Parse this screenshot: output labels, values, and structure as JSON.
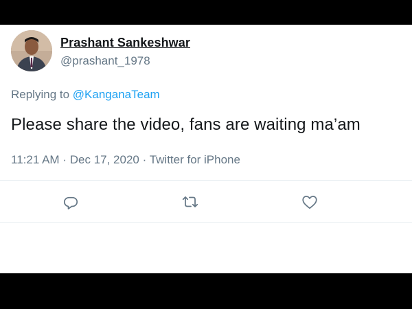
{
  "tweet": {
    "author_name": "Prashant Sankeshwar",
    "author_handle": "@prashant_1978",
    "reply_prefix": "Replying to",
    "reply_handle": "@KanganaTeam",
    "text": "Please share the video, fans are waiting ma’am",
    "time": "11:21 AM",
    "date": "Dec 17, 2020",
    "source": "Twitter for iPhone",
    "separator": "·"
  },
  "actions": [
    {
      "icon": "reply-icon"
    },
    {
      "icon": "retweet-icon"
    },
    {
      "icon": "like-icon"
    }
  ],
  "colors": {
    "text": "#14171a",
    "secondary": "#657786",
    "link": "#1da1f2",
    "divider": "#e6ecf0",
    "letterbox": "#000000"
  }
}
